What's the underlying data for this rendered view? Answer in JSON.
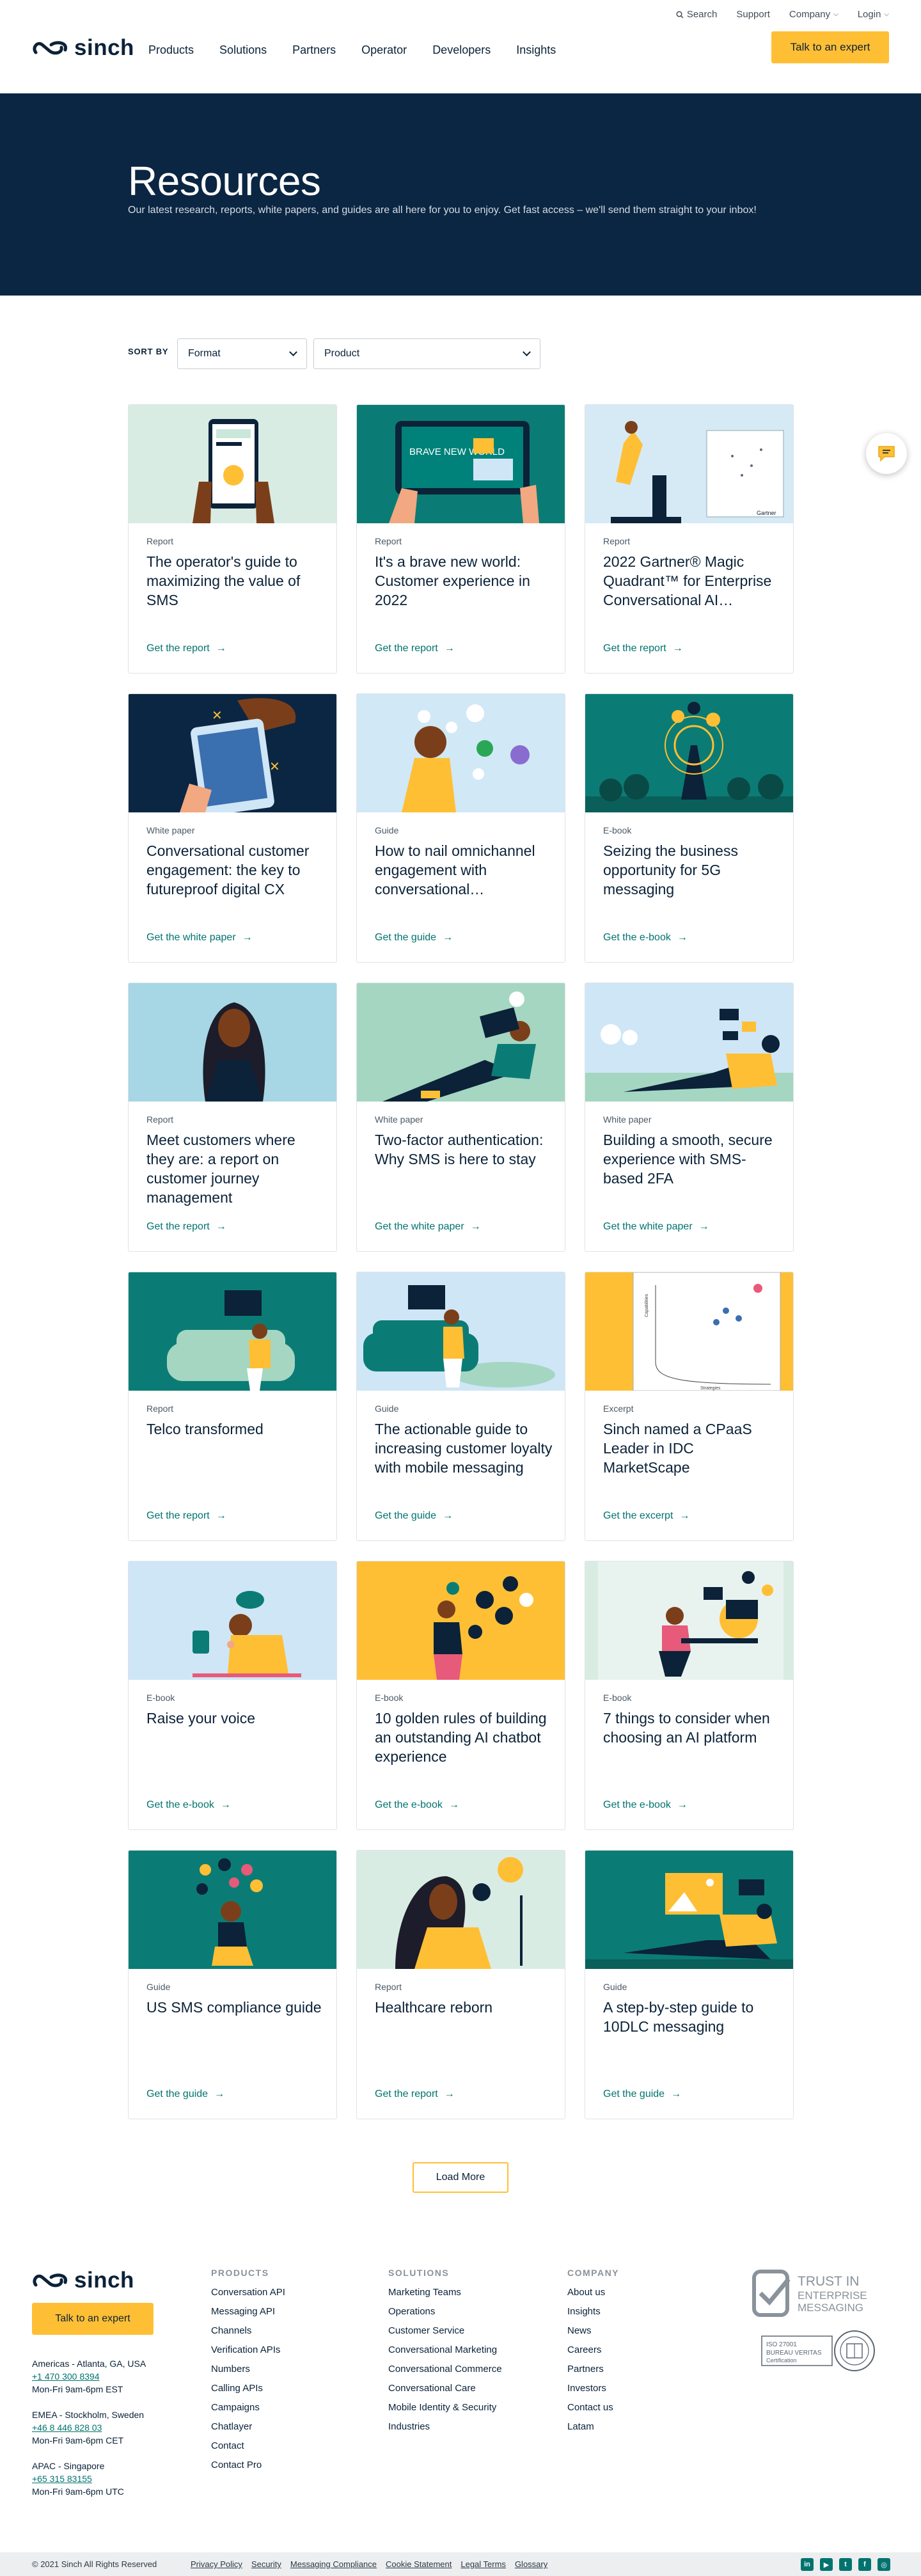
{
  "header": {
    "utility": [
      {
        "label": "Search",
        "icon": "search-icon"
      },
      {
        "label": "Support"
      },
      {
        "label": "Company",
        "dropdown": true
      },
      {
        "label": "Login",
        "dropdown": true
      }
    ],
    "logo": "sinch",
    "nav": [
      "Products",
      "Solutions",
      "Partners",
      "Operator",
      "Developers",
      "Insights"
    ],
    "cta": "Talk to an expert"
  },
  "hero": {
    "title": "Resources",
    "subtitle": "Our latest research, reports, white papers, and guides are all here for you to enjoy. Get fast access – we'll send them straight to your inbox!"
  },
  "filters": {
    "sort_label": "SORT BY",
    "format": "Format",
    "product": "Product"
  },
  "cards": [
    {
      "type": "Report",
      "title": "The operator's guide to maximizing the value of SMS",
      "link": "Get the report",
      "bg": "#d9ece4"
    },
    {
      "type": "Report",
      "title": "It's a brave new world: Customer experience in 2022",
      "link": "Get the report",
      "bg": "#0b7c75"
    },
    {
      "type": "Report",
      "title": "2022 Gartner® Magic Quadrant™ for Enterprise Conversational AI…",
      "link": "Get the report",
      "bg": "#d6eaf6"
    },
    {
      "type": "White paper",
      "title": "Conversational customer engagement: the key to futureproof digital CX",
      "link": "Get the white paper",
      "bg": "#0b2642"
    },
    {
      "type": "Guide",
      "title": "How to nail omnichannel engagement with conversational…",
      "link": "Get the guide",
      "bg": "#d1e8f6"
    },
    {
      "type": "E-book",
      "title": "Seizing the business opportunity for 5G messaging",
      "link": "Get the e-book",
      "bg": "#0b7c75"
    },
    {
      "type": "Report",
      "title": "Meet customers where they are: a report on customer journey management",
      "link": "Get the report",
      "bg": "#a7d6e4"
    },
    {
      "type": "White paper",
      "title": "Two-factor authentication: Why SMS is here to stay",
      "link": "Get the white paper",
      "bg": "#a5d6c2"
    },
    {
      "type": "White paper",
      "title": "Building a smooth, secure experience with SMS-based 2FA",
      "link": "Get the white paper",
      "bg": "#cfe6f6"
    },
    {
      "type": "Report",
      "title": "Telco transformed",
      "link": "Get the report",
      "bg": "#0b7c75"
    },
    {
      "type": "Guide",
      "title": "The actionable guide to increasing customer loyalty with mobile messaging",
      "link": "Get the guide",
      "bg": "#cfe6f6"
    },
    {
      "type": "Excerpt",
      "title": "Sinch named a CPaaS Leader in IDC MarketScape",
      "link": "Get the excerpt",
      "bg": "#ffbf35"
    },
    {
      "type": "E-book",
      "title": "Raise your voice",
      "link": "Get the e-book",
      "bg": "#cfe6f6"
    },
    {
      "type": "E-book",
      "title": "10 golden rules of building an outstanding AI chatbot experience",
      "link": "Get the e-book",
      "bg": "#ffbf35"
    },
    {
      "type": "E-book",
      "title": "7 things to consider when choosing an AI platform",
      "link": "Get the e-book",
      "bg": "#d9ece4"
    },
    {
      "type": "Guide",
      "title": "US SMS compliance guide",
      "link": "Get the guide",
      "bg": "#0b7c75"
    },
    {
      "type": "Report",
      "title": "Healthcare reborn",
      "link": "Get the report",
      "bg": "#d9ece4"
    },
    {
      "type": "Guide",
      "title": "A step-by-step guide to 10DLC messaging",
      "link": "Get the guide",
      "bg": "#0b7c75"
    }
  ],
  "card_art": {
    "2": "BRAVE NEW WORLD",
    "3": "Gartner",
    "12_x": "Strategies",
    "12_y": "Capabilities"
  },
  "load_more": "Load More",
  "footer": {
    "logo": "sinch",
    "cta": "Talk to an expert",
    "offices": [
      {
        "region": "Americas - Atlanta, GA, USA",
        "phone": "+1 470 300 8394",
        "hours": "Mon-Fri 9am-6pm EST"
      },
      {
        "region": "EMEA - Stockholm, Sweden",
        "phone": "+46 8 446 828 03",
        "hours": "Mon-Fri 9am-6pm CET"
      },
      {
        "region": "APAC - Singapore",
        "phone": "+65 315 83155",
        "hours": "Mon-Fri 9am-6pm UTC"
      }
    ],
    "columns": [
      {
        "heading": "PRODUCTS",
        "items": [
          "Conversation API",
          "Messaging API",
          "Channels",
          "Verification APIs",
          "Numbers",
          "Calling APIs",
          "Campaigns",
          "Chatlayer",
          "Contact",
          "Contact Pro"
        ]
      },
      {
        "heading": "SOLUTIONS",
        "items": [
          "Marketing Teams",
          "Operations",
          "Customer Service",
          "Conversational Marketing",
          "Conversational Commerce",
          "Conversational Care",
          "Mobile Identity & Security",
          "Industries"
        ]
      },
      {
        "heading": "COMPANY",
        "items": [
          "About us",
          "Insights",
          "News",
          "Careers",
          "Partners",
          "Investors",
          "Contact us",
          "Latam"
        ]
      }
    ],
    "trust": {
      "line1": "TRUST IN",
      "line2": "ENTERPRISE",
      "line3": "MESSAGING"
    },
    "iso": {
      "line1": "ISO 27001",
      "line2": "BUREAU VERITAS",
      "line3": "Certification"
    }
  },
  "bottom": {
    "copyright": "© 2021 Sinch All Rights Reserved",
    "links": [
      "Privacy Policy",
      "Security",
      "Messaging Compliance",
      "Cookie Statement",
      "Legal Terms",
      "Glossary"
    ],
    "social": [
      {
        "icon": "linkedin-icon",
        "glyph": "in"
      },
      {
        "icon": "youtube-icon",
        "glyph": "▶"
      },
      {
        "icon": "twitter-icon",
        "glyph": "t"
      },
      {
        "icon": "facebook-icon",
        "glyph": "f"
      },
      {
        "icon": "instagram-icon",
        "glyph": "◎"
      }
    ]
  },
  "colors": {
    "navy": "#0b2642",
    "accent": "#ffbf35",
    "teal": "#00736e"
  }
}
